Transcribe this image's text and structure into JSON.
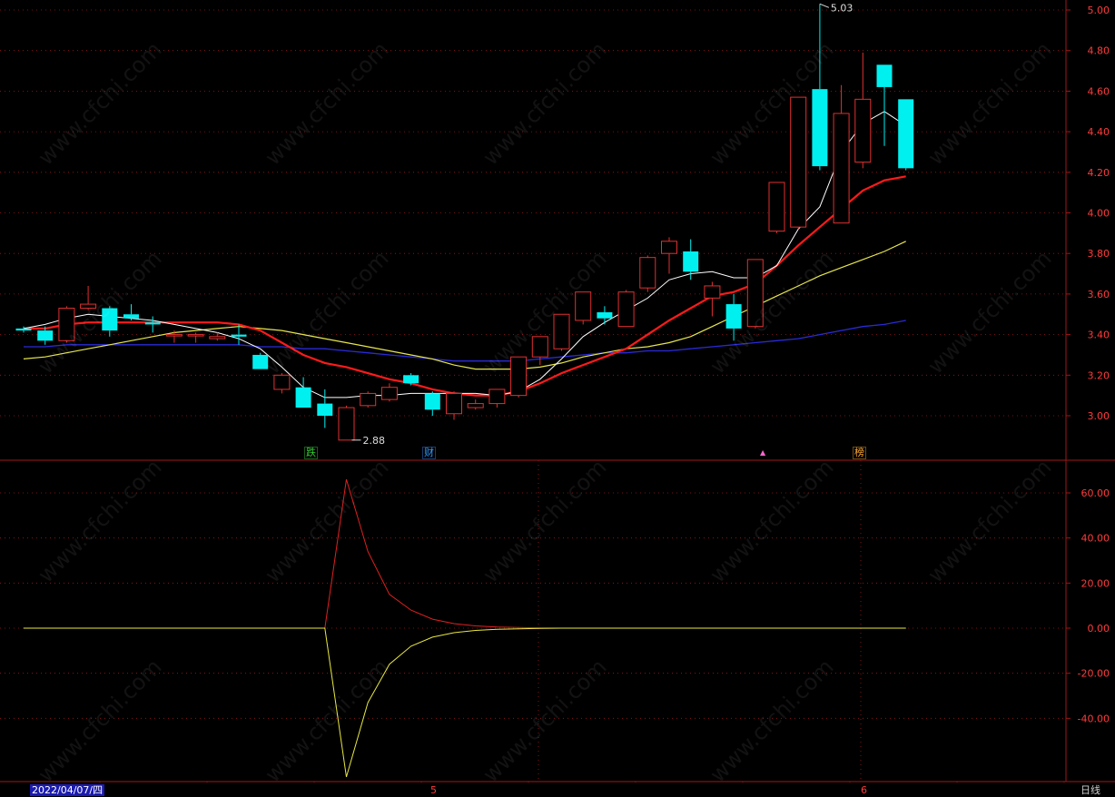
{
  "watermark": "www.cfchi.com",
  "footer": {
    "date": "2022/04/07/四",
    "month_ticks": [
      "5",
      "6"
    ],
    "period": "日线"
  },
  "tags": [
    {
      "text": "跌",
      "color": "#33cc33"
    },
    {
      "text": "财",
      "color": "#3399ff"
    },
    {
      "text": "▲",
      "color": "#ff66cc"
    },
    {
      "text": "榜",
      "color": "#ffaa33"
    }
  ],
  "annotations": {
    "high": "5.03",
    "low": "2.88"
  },
  "colors": {
    "up": "#e03030",
    "down": "#00f0f0",
    "ma5": "#ffffff",
    "ma10": "#ff1a1a",
    "ma20": "#e6e64d",
    "ma60": "#2a2ad8",
    "grid": "#a01818",
    "ind_red": "#e02020",
    "ind_yellow": "#e8e840"
  },
  "chart_data": [
    {
      "type": "candlestick",
      "ylim": [
        2.8,
        5.05
      ],
      "yticks": [
        "3.00",
        "3.20",
        "3.40",
        "3.60",
        "3.80",
        "4.00",
        "4.20",
        "4.40",
        "4.60",
        "4.80",
        "5.00"
      ],
      "ohlc": [
        [
          3.43,
          3.44,
          3.41,
          3.42
        ],
        [
          3.42,
          3.44,
          3.35,
          3.37
        ],
        [
          3.37,
          3.54,
          3.36,
          3.53
        ],
        [
          3.53,
          3.64,
          3.52,
          3.55
        ],
        [
          3.53,
          3.54,
          3.39,
          3.42
        ],
        [
          3.5,
          3.55,
          3.47,
          3.48
        ],
        [
          3.46,
          3.49,
          3.41,
          3.45
        ],
        [
          3.4,
          3.42,
          3.36,
          3.4
        ],
        [
          3.4,
          3.41,
          3.36,
          3.4
        ],
        [
          3.38,
          3.41,
          3.37,
          3.39
        ],
        [
          3.4,
          3.45,
          3.35,
          3.39
        ],
        [
          3.3,
          3.31,
          3.23,
          3.23
        ],
        [
          3.13,
          3.21,
          3.11,
          3.2
        ],
        [
          3.14,
          3.19,
          3.04,
          3.04
        ],
        [
          3.06,
          3.13,
          2.94,
          3.0
        ],
        [
          2.88,
          3.05,
          2.88,
          3.04
        ],
        [
          3.05,
          3.12,
          3.04,
          3.11
        ],
        [
          3.08,
          3.16,
          3.07,
          3.14
        ],
        [
          3.2,
          3.21,
          3.15,
          3.16
        ],
        [
          3.11,
          3.12,
          3.0,
          3.03
        ],
        [
          3.01,
          3.12,
          2.98,
          3.11
        ],
        [
          3.04,
          3.08,
          3.03,
          3.06
        ],
        [
          3.06,
          3.13,
          3.04,
          3.13
        ],
        [
          3.1,
          3.29,
          3.09,
          3.29
        ],
        [
          3.29,
          3.39,
          3.25,
          3.39
        ],
        [
          3.33,
          3.5,
          3.32,
          3.5
        ],
        [
          3.47,
          3.61,
          3.45,
          3.61
        ],
        [
          3.51,
          3.54,
          3.45,
          3.48
        ],
        [
          3.44,
          3.62,
          3.44,
          3.61
        ],
        [
          3.63,
          3.79,
          3.61,
          3.78
        ],
        [
          3.8,
          3.88,
          3.7,
          3.86
        ],
        [
          3.81,
          3.87,
          3.67,
          3.71
        ],
        [
          3.58,
          3.66,
          3.49,
          3.64
        ],
        [
          3.55,
          3.6,
          3.37,
          3.43
        ],
        [
          3.44,
          3.77,
          3.43,
          3.77
        ],
        [
          3.91,
          4.15,
          3.9,
          4.15
        ],
        [
          3.93,
          4.57,
          3.92,
          4.57
        ],
        [
          4.61,
          5.03,
          4.21,
          4.23
        ],
        [
          3.95,
          4.63,
          3.95,
          4.49
        ],
        [
          4.25,
          4.79,
          4.22,
          4.56
        ],
        [
          4.73,
          4.73,
          4.33,
          4.62
        ],
        [
          4.56,
          4.56,
          4.21,
          4.22
        ]
      ],
      "ma5": [
        3.43,
        3.45,
        3.48,
        3.5,
        3.49,
        3.48,
        3.47,
        3.45,
        3.43,
        3.41,
        3.38,
        3.33,
        3.24,
        3.14,
        3.09,
        3.09,
        3.1,
        3.1,
        3.11,
        3.11,
        3.11,
        3.11,
        3.1,
        3.12,
        3.18,
        3.28,
        3.39,
        3.46,
        3.52,
        3.58,
        3.67,
        3.7,
        3.71,
        3.68,
        3.68,
        3.74,
        3.92,
        4.03,
        4.3,
        4.44,
        4.5,
        4.43
      ],
      "ma10": [
        3.43,
        3.43,
        3.45,
        3.46,
        3.46,
        3.46,
        3.46,
        3.46,
        3.46,
        3.46,
        3.45,
        3.42,
        3.36,
        3.3,
        3.26,
        3.24,
        3.21,
        3.18,
        3.16,
        3.13,
        3.11,
        3.1,
        3.1,
        3.12,
        3.16,
        3.21,
        3.25,
        3.29,
        3.33,
        3.4,
        3.47,
        3.53,
        3.59,
        3.61,
        3.65,
        3.74,
        3.84,
        3.93,
        4.02,
        4.11,
        4.16,
        4.18
      ],
      "ma20": [
        3.28,
        3.29,
        3.31,
        3.33,
        3.35,
        3.37,
        3.39,
        3.41,
        3.42,
        3.43,
        3.44,
        3.43,
        3.42,
        3.4,
        3.38,
        3.36,
        3.34,
        3.32,
        3.3,
        3.28,
        3.25,
        3.23,
        3.23,
        3.23,
        3.24,
        3.26,
        3.29,
        3.31,
        3.33,
        3.34,
        3.36,
        3.39,
        3.44,
        3.49,
        3.54,
        3.59,
        3.64,
        3.69,
        3.73,
        3.77,
        3.81,
        3.86
      ],
      "ma60": [
        3.34,
        3.34,
        3.35,
        3.35,
        3.35,
        3.35,
        3.35,
        3.35,
        3.35,
        3.35,
        3.35,
        3.34,
        3.34,
        3.33,
        3.33,
        3.32,
        3.31,
        3.3,
        3.29,
        3.28,
        3.27,
        3.27,
        3.27,
        3.27,
        3.28,
        3.29,
        3.3,
        3.31,
        3.31,
        3.32,
        3.32,
        3.33,
        3.34,
        3.35,
        3.36,
        3.37,
        3.38,
        3.4,
        3.42,
        3.44,
        3.45,
        3.47
      ]
    },
    {
      "type": "line",
      "ylim": [
        -67,
        67
      ],
      "yticks": [
        "60.00",
        "40.00",
        "20.00",
        "0.00",
        "-20.00",
        "-40.00"
      ],
      "series": [
        {
          "values": [
            0,
            0,
            0,
            0,
            0,
            0,
            0,
            0,
            0,
            0,
            0,
            0,
            0,
            0,
            0,
            66,
            34,
            15,
            8,
            4,
            2,
            1,
            0.5,
            0.3,
            0.1,
            0,
            0,
            0,
            0,
            0,
            0,
            0,
            0,
            0,
            0,
            0,
            0,
            0,
            0,
            0,
            0,
            0
          ]
        },
        {
          "values": [
            0,
            0,
            0,
            0,
            0,
            0,
            0,
            0,
            0,
            0,
            0,
            0,
            0,
            0,
            0,
            -66,
            -33,
            -16,
            -8,
            -4,
            -2,
            -1,
            -0.5,
            -0.3,
            -0.1,
            0,
            0,
            0,
            0,
            0,
            0,
            0,
            0,
            0,
            0,
            0,
            0,
            0,
            0,
            0,
            0,
            0
          ]
        }
      ]
    }
  ]
}
